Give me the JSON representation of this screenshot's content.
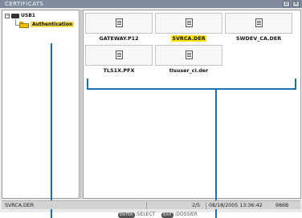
{
  "window": {
    "title": "CERTIFICATS",
    "minimize_glyph": "▫",
    "close_glyph": "✕"
  },
  "tree": {
    "root": {
      "label": "USB1",
      "expander": "−"
    },
    "children": [
      {
        "label": "Authentication"
      }
    ]
  },
  "files": [
    {
      "name": "GATEWAY.P12",
      "selected": false
    },
    {
      "name": "SVRCA.DER",
      "selected": true
    },
    {
      "name": "SWDEV_CA.DER",
      "selected": false
    },
    {
      "name": "TLS1X.PFX",
      "selected": false
    },
    {
      "name": "tlsuser_cl.der",
      "selected": false
    }
  ],
  "status": {
    "filename": "SVRCA.DER",
    "page": "2/5",
    "datetime": "08/18/2005 13:36:42",
    "size": "986B"
  },
  "hints": {
    "enter_key": "ENTER",
    "select": ":SELECT",
    "exit_key": "EXIT",
    "dossier": ":DOSSIER"
  },
  "colors": {
    "accent": "#1d6fb7",
    "selection": "#ffe600",
    "titlebar": "#7f8a9c"
  }
}
